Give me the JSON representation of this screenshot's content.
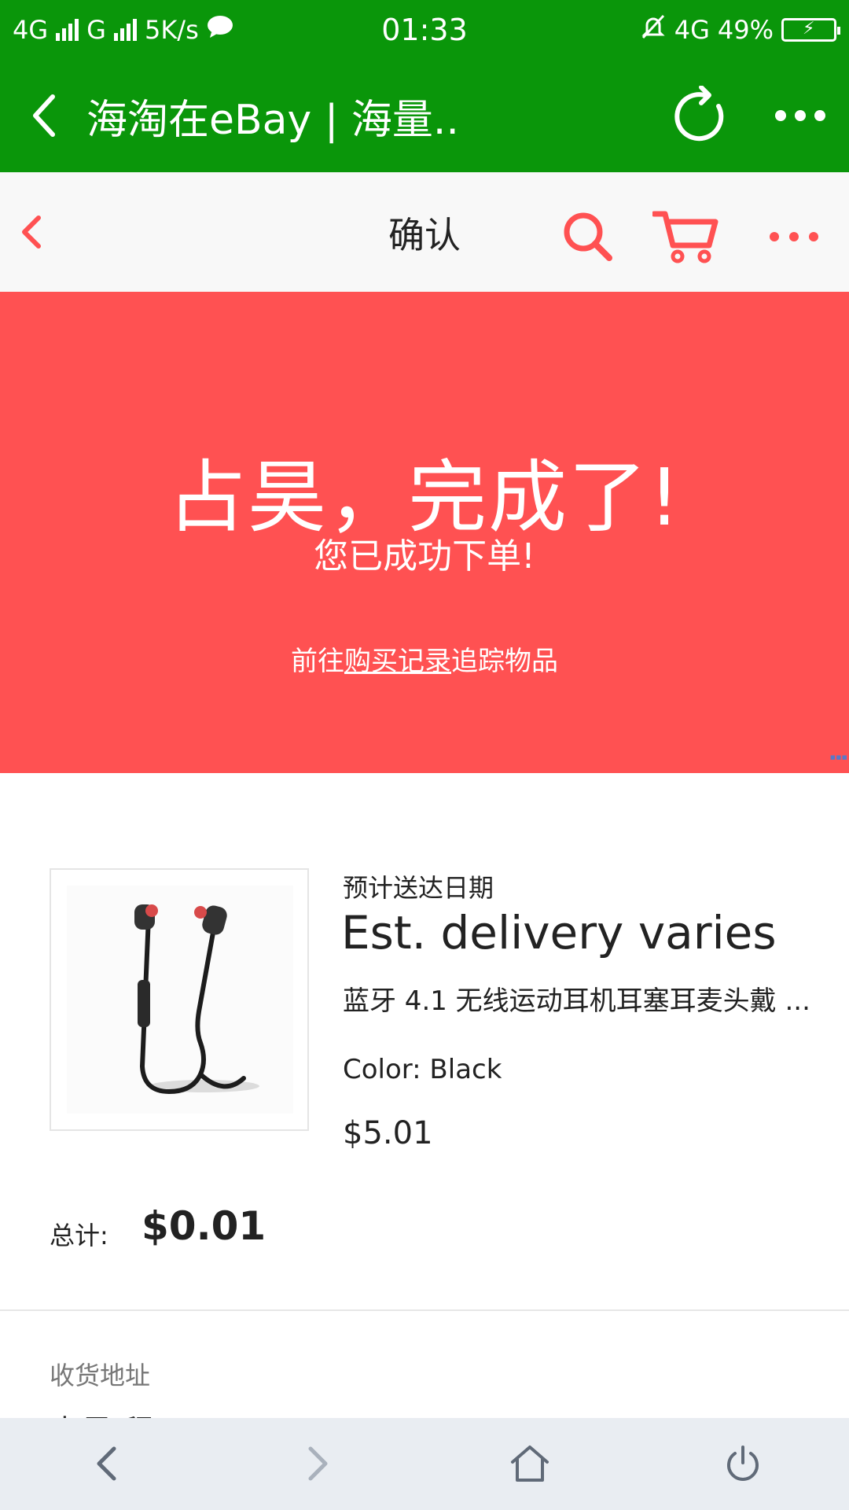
{
  "status_bar": {
    "network_1": "4G",
    "network_2": "G",
    "speed": "5K/s",
    "time": "01:33",
    "network_3": "4G",
    "battery": "49%"
  },
  "app_bar": {
    "title": "海淘在eBay | 海量.."
  },
  "ebay_header": {
    "title": "确认"
  },
  "hero": {
    "headline": "占昊，完成了!",
    "subtitle": "您已成功下单!",
    "track_prefix": "前往",
    "track_link": "购买记录",
    "track_suffix": "追踪物品"
  },
  "item": {
    "delivery_label": "预计送达日期",
    "delivery_value": "Est. delivery varies",
    "title": "蓝牙 4.1 无线运动耳机耳塞耳麦头戴 ...",
    "variant": "Color: Black",
    "price": "$5.01"
  },
  "total": {
    "label": "总计:",
    "value": "$0.01"
  },
  "address": {
    "label": "收货地址",
    "name_peek": "占昊 程"
  },
  "colors": {
    "wechat_green": "#0a960a",
    "ebay_red": "#ff5152"
  }
}
